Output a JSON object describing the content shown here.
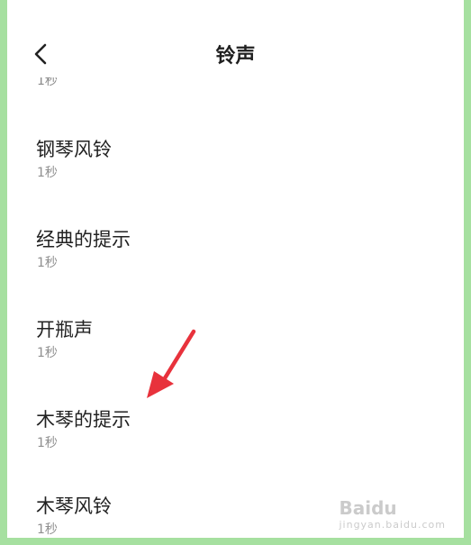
{
  "header": {
    "title": "铃声"
  },
  "partial_item": {
    "subtitle": "1秒"
  },
  "ringtones": [
    {
      "title": "钢琴风铃",
      "duration": "1秒"
    },
    {
      "title": "经典的提示",
      "duration": "1秒"
    },
    {
      "title": "开瓶声",
      "duration": "1秒"
    },
    {
      "title": "木琴的提示",
      "duration": "1秒"
    },
    {
      "title": "木琴风铃",
      "duration": "1秒"
    }
  ],
  "annotation": {
    "arrow_color": "#e8323c",
    "points_to": "木琴的提示"
  },
  "watermark": {
    "brand": "Baidu",
    "sub": "jingyan.baidu.com"
  },
  "colors": {
    "frame_border": "#a6e0a0",
    "background": "#ffffff",
    "arrow": "#e8323c"
  }
}
